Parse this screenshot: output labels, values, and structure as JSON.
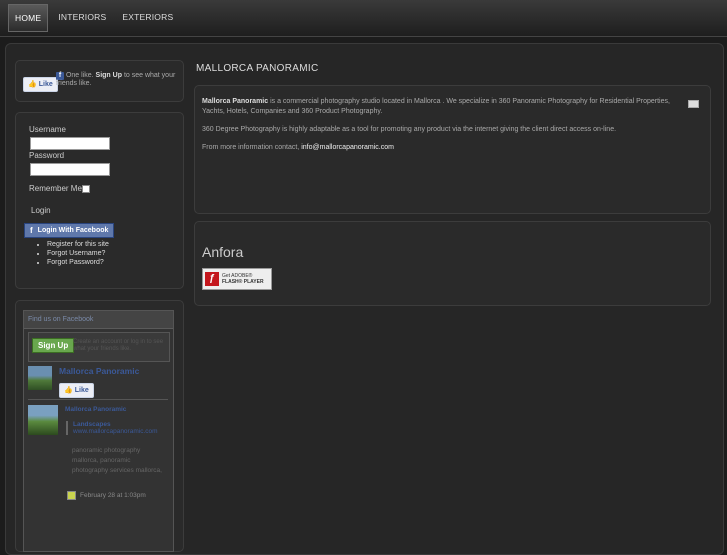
{
  "nav": [
    {
      "label": "HOME",
      "active": true
    },
    {
      "label": "INTERIORS",
      "active": false
    },
    {
      "label": "EXTERIORS",
      "active": false
    }
  ],
  "fb_like": {
    "button": "Like",
    "text_before": "One like.",
    "signup": "Sign Up",
    "text_after": "to see what your friends like."
  },
  "login": {
    "username_label": "Username",
    "password_label": "Password",
    "remember_label": "Remember Me",
    "login_button": "Login",
    "fb_button": "Login With Facebook",
    "links": [
      "Register for this site",
      "Forgot Username?",
      "Forgot Password?"
    ]
  },
  "fb_widget": {
    "header": "Find us on Facebook",
    "signup_button": "Sign Up",
    "signup_text": "Create an account or log in to see what your friends like.",
    "page_name": "Mallorca Panoramic",
    "like_button": "Like",
    "post_author": "Mallorca Panoramic",
    "post_link_title": "Landscapes",
    "post_link_url": "www.mallorcapanoramic.com",
    "post_desc": "panoramic photography mallorca, panoramic photography services mallorca,",
    "post_date": "February 28 at 1:03pm"
  },
  "article": {
    "title": "MALLORCA PANORAMIC",
    "company": "Mallorca Panoramic",
    "p1": "is a commercial photography studio located in Mallorca . We specialize in 360 Panoramic Photography for Residential Properties, Yachts, Hotels, Companies and 360 Product Photography.",
    "p2": "360 Degree Photography is highly adaptable as a tool for promoting any product via the internet giving the client direct access on-line.",
    "p3": "From more information contact,",
    "email": "info@mallorcapanoramic.com"
  },
  "anfora": {
    "title": "Anfora",
    "flash_small": "Get ADOBE®",
    "flash_big": "FLASH® PLAYER"
  }
}
